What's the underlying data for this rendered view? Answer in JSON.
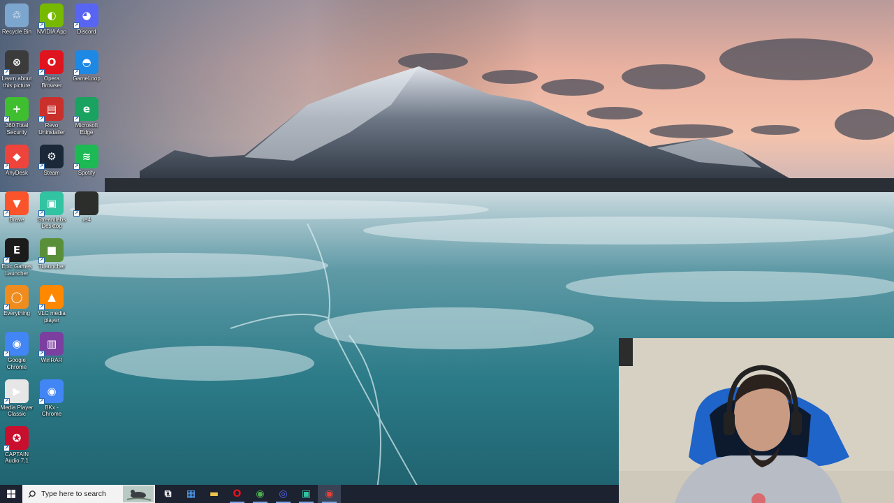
{
  "desktop": {
    "icons": [
      {
        "label": "Recycle Bin",
        "icon": "recycle-bin-icon",
        "color": "#7da6cf"
      },
      {
        "label": "NVIDIA App",
        "icon": "nvidia-icon",
        "color": "#76b900"
      },
      {
        "label": "Discord",
        "icon": "discord-icon",
        "color": "#5865f2"
      },
      {
        "label": "Learn about\nthis picture",
        "icon": "learn-picture-icon",
        "color": "#3b3b3b"
      },
      {
        "label": "Opera\nBrowser",
        "icon": "opera-icon",
        "color": "#e0141e"
      },
      {
        "label": "GameLoop",
        "icon": "gameloop-icon",
        "color": "#1e88e5"
      },
      {
        "label": "360 Total\nSecurity",
        "icon": "360-security-icon",
        "color": "#3fbf2f"
      },
      {
        "label": "Revo\nUninstaller",
        "icon": "revo-uninstaller-icon",
        "color": "#c9302c"
      },
      {
        "label": "Microsoft\nEdge",
        "icon": "edge-icon",
        "color": "#1aa260"
      },
      {
        "label": "AnyDesk",
        "icon": "anydesk-icon",
        "color": "#ef443b"
      },
      {
        "label": "Steam",
        "icon": "steam-icon",
        "color": "#1b2838"
      },
      {
        "label": "Spotify",
        "icon": "spotify-icon",
        "color": "#1db954"
      },
      {
        "label": "Brave",
        "icon": "brave-icon",
        "color": "#fb542b"
      },
      {
        "label": "Streamlabs\nDesktop",
        "icon": "streamlabs-icon",
        "color": "#31c3a2"
      },
      {
        "label": "re4",
        "icon": "re4-icon",
        "color": "#2b2e2a"
      },
      {
        "label": "Epic Games\nLauncher",
        "icon": "epic-games-icon",
        "color": "#1b1b1b"
      },
      {
        "label": "TLauncher",
        "icon": "tlauncher-icon",
        "color": "#5a8f3a"
      },
      {
        "label": "Everything",
        "icon": "everything-icon",
        "color": "#f08c1e"
      },
      {
        "label": "VLC media\nplayer",
        "icon": "vlc-icon",
        "color": "#ff8800"
      },
      {
        "label": "Google\nChrome",
        "icon": "chrome-icon",
        "color": "#4285f4"
      },
      {
        "label": "WinRAR",
        "icon": "winrar-icon",
        "color": "#7b3fa0"
      },
      {
        "label": "Media Player\nClassic",
        "icon": "media-player-classic-icon",
        "color": "#e6e6e6"
      },
      {
        "label": "BKx -\nChrome",
        "icon": "bkx-chrome-icon",
        "color": "#4285f4"
      },
      {
        "label": "CAPTAIN\nAudio 7.1",
        "icon": "captain-audio-icon",
        "color": "#c8102e"
      }
    ]
  },
  "taskbar": {
    "search_placeholder": "Type here to search",
    "buttons": [
      {
        "name": "task-view-icon",
        "glyph": "⧉"
      },
      {
        "name": "ms-store-icon",
        "glyph": "▦"
      },
      {
        "name": "file-explorer-icon",
        "glyph": "▬"
      },
      {
        "name": "opera-taskbar-icon",
        "glyph": "O"
      },
      {
        "name": "chrome-taskbar-icon",
        "glyph": "◉"
      },
      {
        "name": "discord-taskbar-icon",
        "glyph": "◎"
      },
      {
        "name": "streamlabs-taskbar-icon",
        "glyph": "▣"
      },
      {
        "name": "chrome-taskbar-icon-2",
        "glyph": "◉"
      }
    ]
  }
}
